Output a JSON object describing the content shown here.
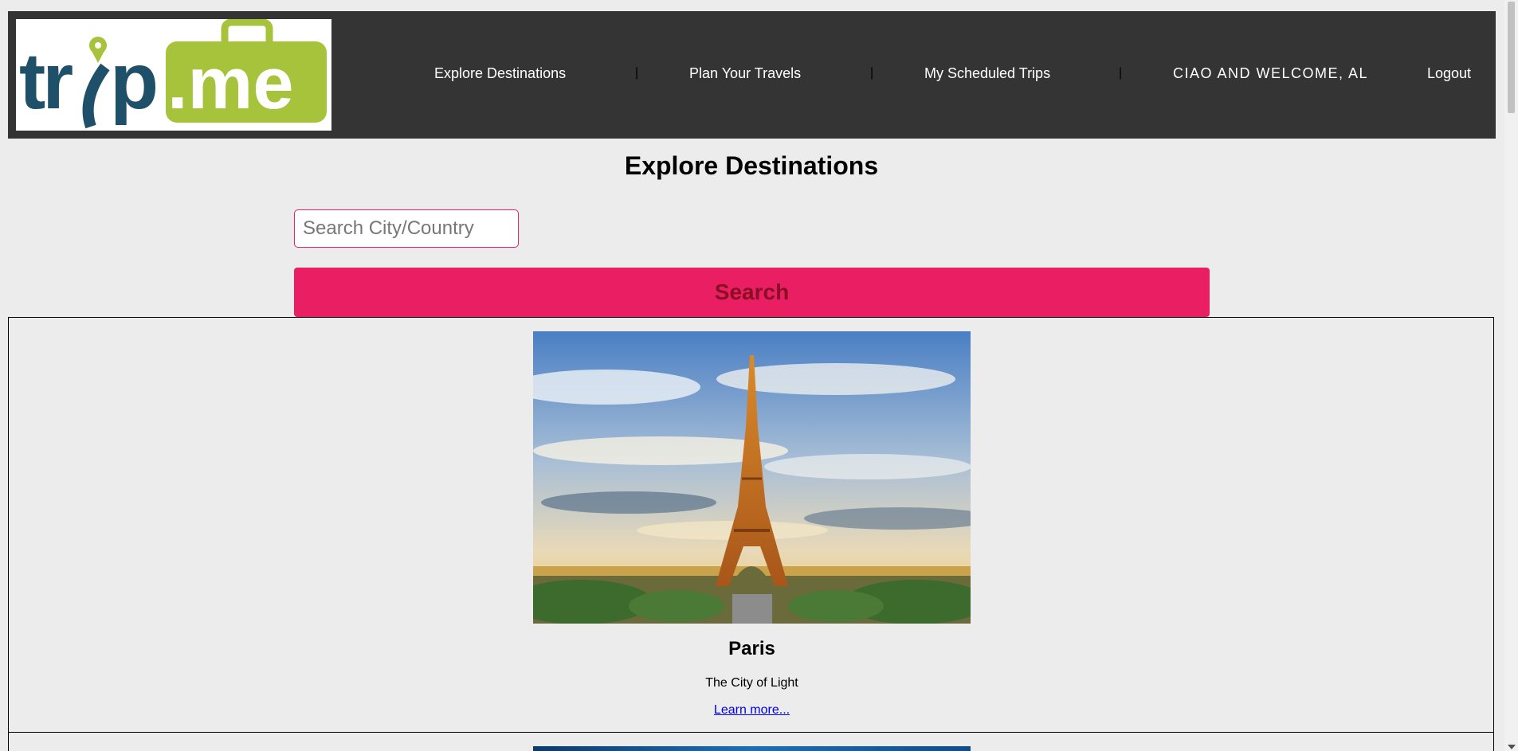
{
  "header": {
    "logo": {
      "text_trip": "trip",
      "text_me": ".me",
      "icon": "suitcase-pin-logo"
    },
    "nav": {
      "explore": "Explore Destinations",
      "plan": "Plan Your Travels",
      "scheduled": "My Scheduled Trips",
      "separator": "|"
    },
    "welcome": "CIAO AND WELCOME, AL",
    "logout": "Logout"
  },
  "main": {
    "title": "Explore Destinations",
    "search": {
      "placeholder": "Search City/Country",
      "value": "",
      "button_label": "Search"
    },
    "destinations": [
      {
        "name": "Paris",
        "tagline": "The City of Light",
        "link_label": "Learn more...",
        "image": "eiffel-tower-photo"
      },
      {
        "image": "blue-photo"
      }
    ]
  },
  "colors": {
    "header_bg": "#343434",
    "accent": "#e91e63",
    "logo_dark": "#1f5069",
    "logo_green": "#a6c33b",
    "page_bg": "#ececec"
  }
}
